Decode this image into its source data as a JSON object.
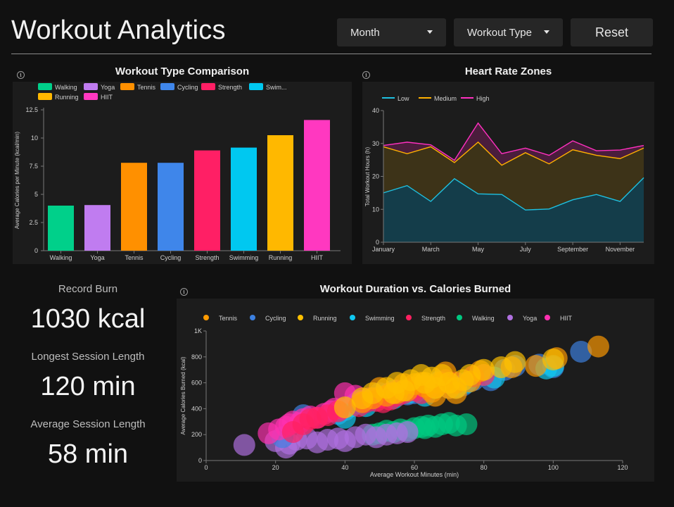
{
  "header": {
    "title": "Workout Analytics",
    "month_label": "Month",
    "workout_type_label": "Workout Type",
    "reset_label": "Reset"
  },
  "stats": {
    "record_burn_label": "Record Burn",
    "record_burn_value": "1030 kcal",
    "longest_label": "Longest Session Length",
    "longest_value": "120 min",
    "average_label": "Average Session Length",
    "average_value": "58 min"
  },
  "info_icon": "info-icon",
  "chart_data": [
    {
      "id": "bar",
      "type": "bar",
      "title": "Workout Type Comparison",
      "xlabel": "",
      "ylabel": "Average Calories per Minute (kcal/min)",
      "categories": [
        "Walking",
        "Yoga",
        "Tennis",
        "Cycling",
        "Strength",
        "Swimming",
        "Running",
        "HIIT"
      ],
      "values": [
        4.0,
        4.05,
        7.8,
        7.8,
        8.9,
        9.15,
        10.25,
        11.6
      ],
      "colors": [
        "#00d08a",
        "#c07cf0",
        "#ff9000",
        "#3f86ea",
        "#ff1f65",
        "#00c8f0",
        "#ffb800",
        "#ff38c0"
      ],
      "legend": [
        "Walking",
        "Yoga",
        "Tennis",
        "Cycling",
        "Strength",
        "Swim...",
        "Running",
        "HIIT"
      ],
      "ylim": [
        0,
        12.5
      ],
      "yticks": [
        0,
        2.5,
        5,
        7.5,
        10,
        12.5
      ],
      "ytick_labels": [
        "0",
        "2.5",
        "5",
        "7.5",
        "10",
        "12.5"
      ],
      "grid": false
    },
    {
      "id": "area",
      "type": "area",
      "title": "Heart Rate Zones",
      "xlabel": "",
      "ylabel": "Total Workout Hours (h)",
      "x": [
        "January",
        "February",
        "March",
        "April",
        "May",
        "June",
        "July",
        "August",
        "September",
        "October",
        "November",
        "December"
      ],
      "xtick_labels": [
        "January",
        "March",
        "May",
        "July",
        "September",
        "November"
      ],
      "series": [
        {
          "name": "Low",
          "color": "#1ec0e0",
          "values": [
            15,
            17.2,
            12.4,
            19.3,
            14.7,
            14.5,
            9.8,
            10.1,
            12.9,
            14.5,
            12.4,
            19.6
          ]
        },
        {
          "name": "Medium",
          "color": "#ffb000",
          "values": [
            29,
            26.9,
            29,
            24.2,
            30.4,
            23.4,
            27.2,
            23.8,
            28.1,
            26.4,
            25.4,
            28.6
          ]
        },
        {
          "name": "High",
          "color": "#ff30c0",
          "values": [
            29.4,
            30.4,
            29.6,
            24.9,
            36.2,
            26.9,
            28.6,
            26.4,
            30.8,
            27.8,
            28.0,
            29.4
          ]
        }
      ],
      "ylim": [
        0,
        40
      ],
      "yticks": [
        0,
        10,
        20,
        30,
        40
      ],
      "legend_position": "top-left",
      "grid": false
    },
    {
      "id": "scatter",
      "type": "scatter",
      "title": "Workout Duration vs. Calories Burned",
      "xlabel": "Average Workout Minutes (min)",
      "ylabel": "Average Calories Burned (kcal)",
      "xlim": [
        0,
        120
      ],
      "ylim": [
        0,
        1000
      ],
      "xticks": [
        0,
        20,
        40,
        60,
        80,
        100,
        120
      ],
      "yticks": [
        0,
        200,
        400,
        600,
        800,
        1000
      ],
      "ytick_labels": [
        "0",
        "200",
        "400",
        "600",
        "800",
        "1K"
      ],
      "legend_position": "top-left",
      "grid": false,
      "series": [
        {
          "name": "Tennis",
          "color": "#ff9a00",
          "points": [
            [
              45,
              450
            ],
            [
              48,
              480
            ],
            [
              50,
              560
            ],
            [
              52,
              500
            ],
            [
              55,
              520
            ],
            [
              57,
              590
            ],
            [
              58,
              540
            ],
            [
              60,
              590
            ],
            [
              62,
              600
            ],
            [
              63,
              570
            ],
            [
              65,
              530
            ],
            [
              66,
              500
            ],
            [
              67,
              600
            ],
            [
              69,
              680
            ],
            [
              70,
              560
            ],
            [
              72,
              520
            ],
            [
              76,
              610
            ],
            [
              79,
              690
            ],
            [
              88,
              720
            ],
            [
              95,
              730
            ],
            [
              101,
              790
            ],
            [
              113,
              880
            ]
          ]
        },
        {
          "name": "Cycling",
          "color": "#3c80e0",
          "points": [
            [
              22,
              180
            ],
            [
              28,
              350
            ],
            [
              38,
              360
            ],
            [
              40,
              390
            ],
            [
              43,
              440
            ],
            [
              45,
              460
            ],
            [
              50,
              520
            ],
            [
              54,
              540
            ],
            [
              58,
              510
            ],
            [
              60,
              520
            ],
            [
              62,
              560
            ],
            [
              63,
              580
            ],
            [
              67,
              610
            ],
            [
              72,
              560
            ],
            [
              74,
              580
            ],
            [
              77,
              620
            ],
            [
              82,
              620
            ],
            [
              86,
              700
            ],
            [
              89,
              730
            ],
            [
              96,
              740
            ],
            [
              100,
              720
            ],
            [
              108,
              840
            ]
          ]
        },
        {
          "name": "Running",
          "color": "#ffc000",
          "points": [
            [
              40,
              410
            ],
            [
              45,
              480
            ],
            [
              48,
              520
            ],
            [
              52,
              560
            ],
            [
              54,
              520
            ],
            [
              55,
              600
            ],
            [
              57,
              540
            ],
            [
              59,
              620
            ],
            [
              62,
              660
            ],
            [
              63,
              600
            ],
            [
              65,
              640
            ],
            [
              66,
              560
            ],
            [
              68,
              660
            ],
            [
              70,
              600
            ],
            [
              72,
              560
            ],
            [
              74,
              620
            ],
            [
              76,
              660
            ],
            [
              80,
              700
            ],
            [
              85,
              720
            ],
            [
              89,
              760
            ],
            [
              100,
              780
            ]
          ]
        },
        {
          "name": "Swimming",
          "color": "#10c8f0",
          "points": [
            [
              40,
              330
            ],
            [
              42,
              420
            ],
            [
              44,
              460
            ],
            [
              46,
              420
            ],
            [
              48,
              480
            ],
            [
              52,
              510
            ],
            [
              54,
              480
            ],
            [
              58,
              520
            ],
            [
              60,
              540
            ],
            [
              63,
              500
            ],
            [
              66,
              560
            ],
            [
              70,
              560
            ],
            [
              72,
              570
            ],
            [
              75,
              600
            ],
            [
              80,
              660
            ],
            [
              83,
              640
            ],
            [
              98,
              710
            ],
            [
              100,
              730
            ]
          ]
        },
        {
          "name": "Strength",
          "color": "#ff2060",
          "points": [
            [
              25,
              220
            ],
            [
              28,
              280
            ],
            [
              30,
              320
            ],
            [
              32,
              330
            ],
            [
              35,
              350
            ],
            [
              38,
              380
            ],
            [
              44,
              420
            ],
            [
              46,
              450
            ],
            [
              49,
              460
            ],
            [
              51,
              450
            ],
            [
              53,
              470
            ],
            [
              55,
              500
            ],
            [
              57,
              520
            ],
            [
              60,
              540
            ],
            [
              62,
              520
            ],
            [
              64,
              560
            ],
            [
              66,
              570
            ],
            [
              69,
              620
            ],
            [
              72,
              600
            ],
            [
              77,
              650
            ],
            [
              80,
              660
            ]
          ]
        },
        {
          "name": "Walking",
          "color": "#00c880",
          "points": [
            [
              48,
              200
            ],
            [
              50,
              210
            ],
            [
              52,
              230
            ],
            [
              54,
              220
            ],
            [
              56,
              240
            ],
            [
              58,
              230
            ],
            [
              60,
              250
            ],
            [
              62,
              260
            ],
            [
              63,
              250
            ],
            [
              64,
              270
            ],
            [
              66,
              260
            ],
            [
              68,
              280
            ],
            [
              70,
              290
            ],
            [
              72,
              270
            ],
            [
              75,
              280
            ]
          ]
        },
        {
          "name": "Yoga",
          "color": "#b070e0",
          "points": [
            [
              11,
              120
            ],
            [
              20,
              150
            ],
            [
              23,
              100
            ],
            [
              24,
              130
            ],
            [
              26,
              160
            ],
            [
              29,
              170
            ],
            [
              32,
              140
            ],
            [
              35,
              160
            ],
            [
              38,
              170
            ],
            [
              40,
              150
            ],
            [
              43,
              180
            ],
            [
              46,
              200
            ],
            [
              49,
              180
            ],
            [
              52,
              200
            ],
            [
              55,
              210
            ],
            [
              58,
              220
            ]
          ]
        },
        {
          "name": "HIIT",
          "color": "#ff30b0",
          "points": [
            [
              18,
              210
            ],
            [
              21,
              240
            ],
            [
              23,
              260
            ],
            [
              24,
              280
            ],
            [
              25,
              300
            ],
            [
              27,
              290
            ],
            [
              28,
              320
            ],
            [
              30,
              340
            ],
            [
              32,
              330
            ],
            [
              34,
              360
            ],
            [
              36,
              380
            ],
            [
              37,
              400
            ],
            [
              39,
              400
            ],
            [
              40,
              520
            ],
            [
              43,
              500
            ],
            [
              45,
              460
            ],
            [
              47,
              480
            ],
            [
              50,
              490
            ],
            [
              53,
              520
            ],
            [
              55,
              540
            ],
            [
              60,
              560
            ],
            [
              68,
              600
            ]
          ]
        }
      ]
    }
  ]
}
